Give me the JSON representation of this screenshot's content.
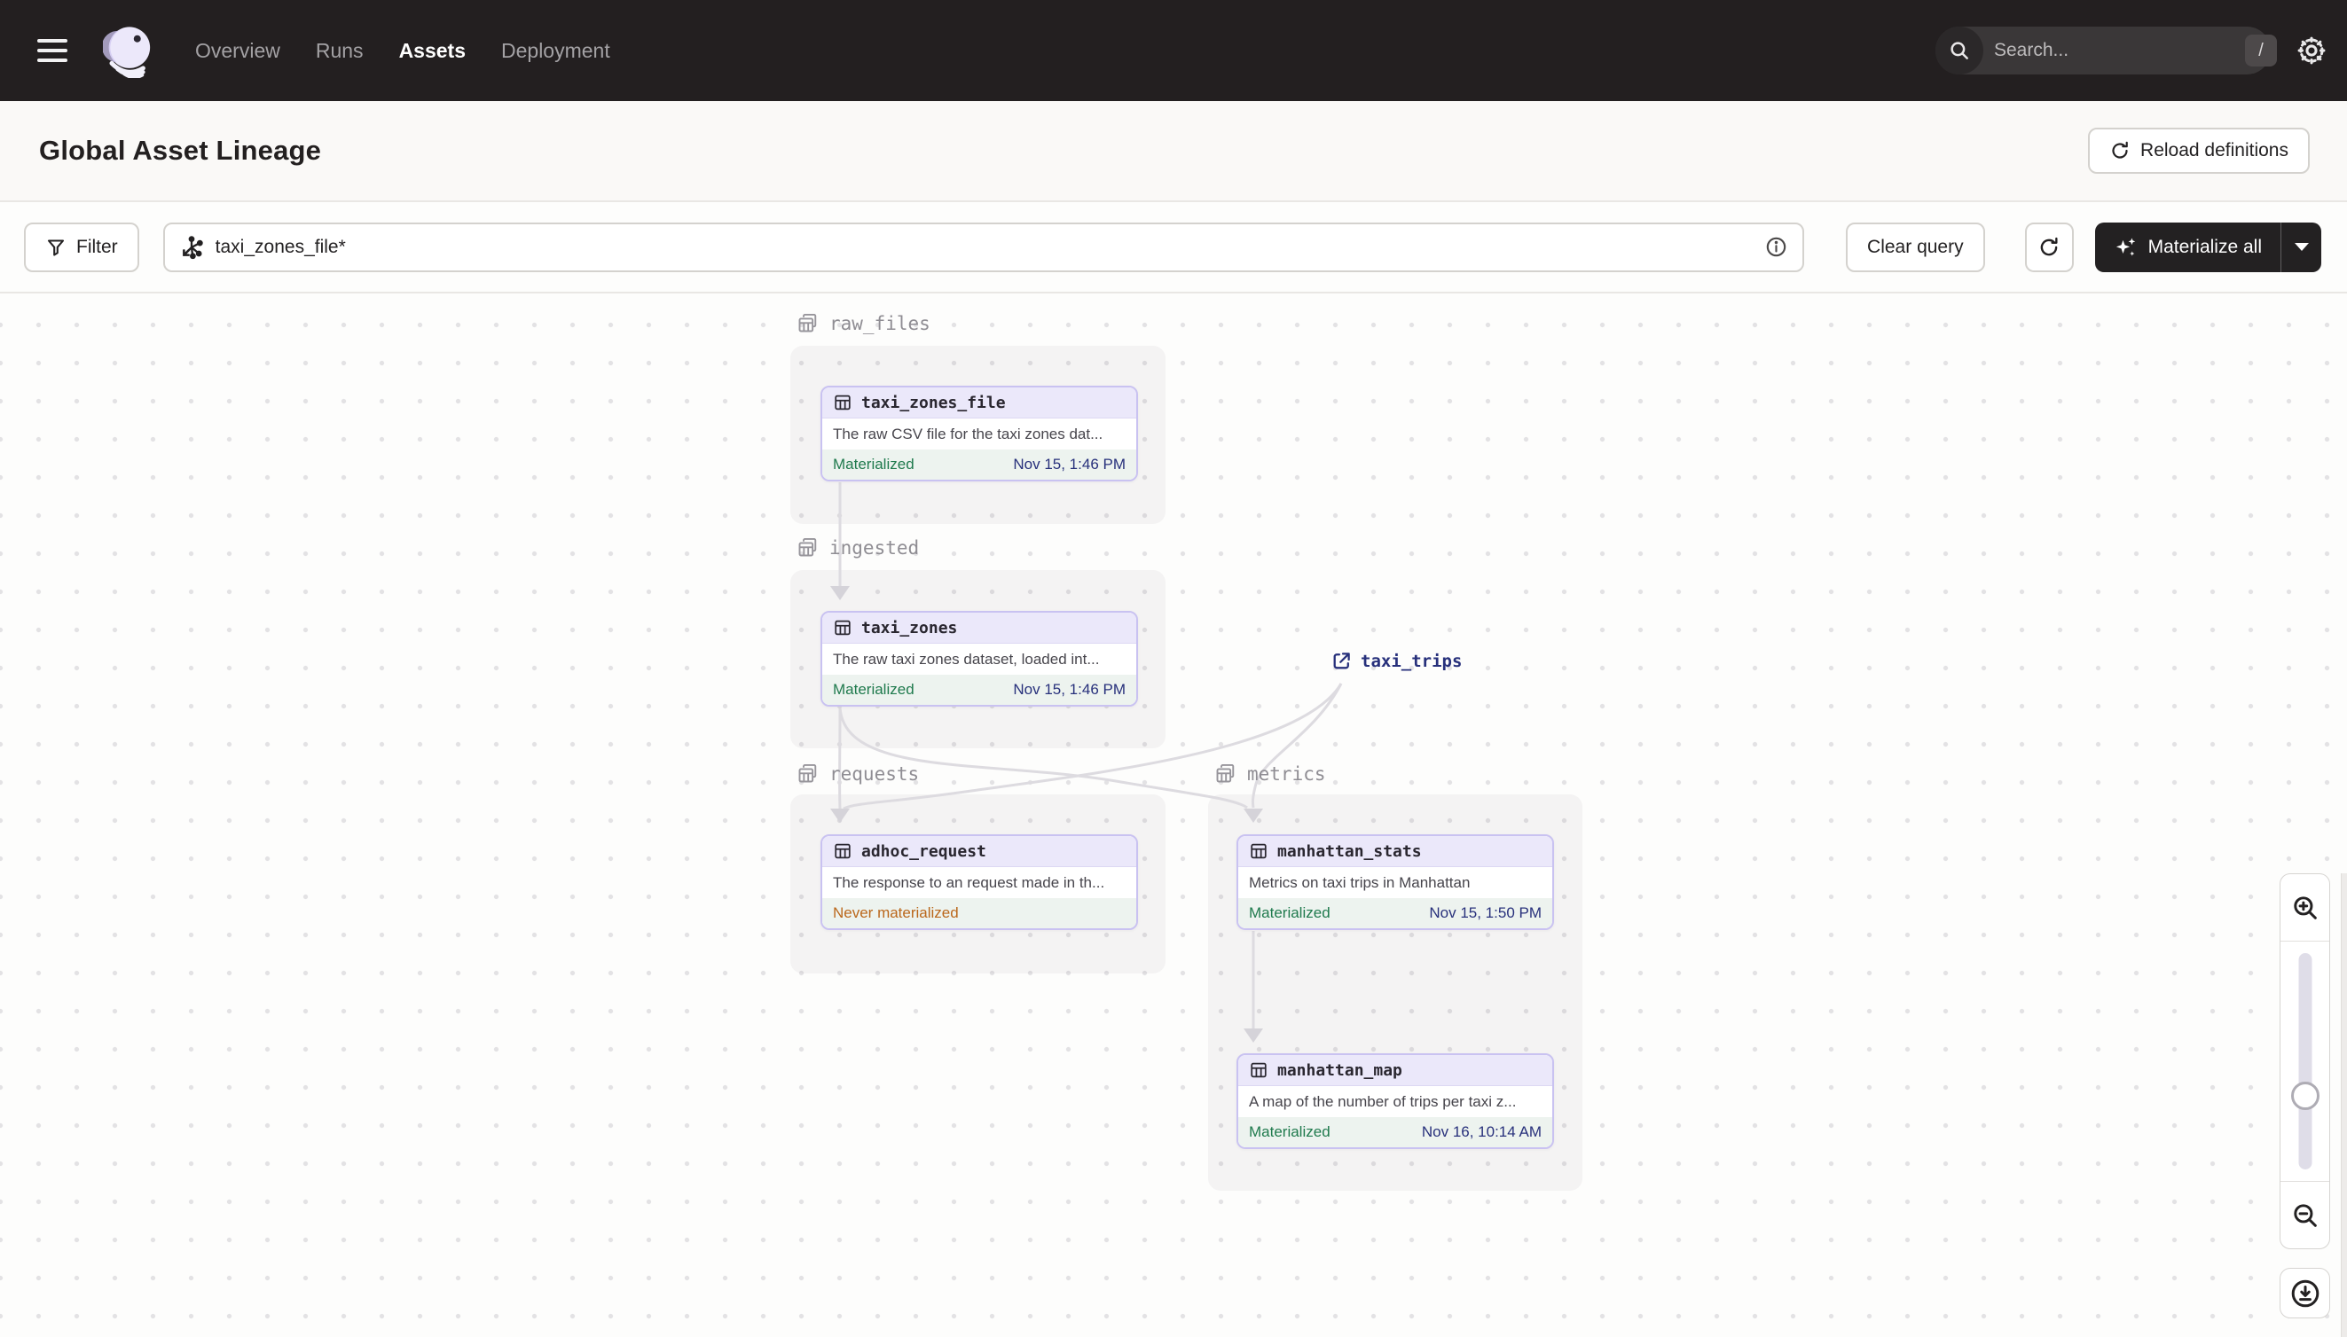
{
  "colors": {
    "nav_bg": "#231F20",
    "header_bg": "#FAF9F7",
    "node_border": "#C9C2F1",
    "node_header_bg": "#EBE8FA",
    "node_footer_bg": "#EDF3EF",
    "status_materialized": "#1F7A4D",
    "status_never_materialized": "#BA671B",
    "timestamp_navy": "#27307B",
    "group_label_gray": "#8F8D93",
    "edge_gray": "#DDDBE0"
  },
  "nav": {
    "items": [
      {
        "label": "Overview",
        "active": false
      },
      {
        "label": "Runs",
        "active": false
      },
      {
        "label": "Assets",
        "active": true
      },
      {
        "label": "Deployment",
        "active": false
      }
    ],
    "search_placeholder": "Search...",
    "search_shortcut": "/"
  },
  "header": {
    "title": "Global Asset Lineage",
    "reload_button": "Reload definitions"
  },
  "toolbar": {
    "filter_label": "Filter",
    "query_value": "taxi_zones_file*",
    "clear_button": "Clear query",
    "materialize_button": "Materialize all"
  },
  "graph": {
    "groups": [
      {
        "name": "raw_files"
      },
      {
        "name": "ingested"
      },
      {
        "name": "requests"
      },
      {
        "name": "metrics"
      }
    ],
    "nodes": [
      {
        "name": "taxi_zones_file",
        "group": "raw_files",
        "description": "The raw CSV file for the taxi zones dat...",
        "status": "Materialized",
        "time": "Nov 15, 1:46 PM"
      },
      {
        "name": "taxi_zones",
        "group": "ingested",
        "description": "The raw taxi zones dataset, loaded int...",
        "status": "Materialized",
        "time": "Nov 15, 1:46 PM"
      },
      {
        "name": "adhoc_request",
        "group": "requests",
        "description": "The response to an request made in th...",
        "status": "Never materialized",
        "time": ""
      },
      {
        "name": "manhattan_stats",
        "group": "metrics",
        "description": "Metrics on taxi trips in Manhattan",
        "status": "Materialized",
        "time": "Nov 15, 1:50 PM"
      },
      {
        "name": "manhattan_map",
        "group": "metrics",
        "description": "A map of the number of trips per taxi z...",
        "status": "Materialized",
        "time": "Nov 16, 10:14 AM"
      }
    ],
    "external_assets": [
      {
        "name": "taxi_trips"
      }
    ],
    "edges": [
      {
        "from": "taxi_zones_file",
        "to": "taxi_zones"
      },
      {
        "from": "taxi_zones",
        "to": "adhoc_request"
      },
      {
        "from": "taxi_zones",
        "to": "manhattan_stats"
      },
      {
        "from": "taxi_trips",
        "to": "adhoc_request"
      },
      {
        "from": "taxi_trips",
        "to": "manhattan_stats"
      },
      {
        "from": "manhattan_stats",
        "to": "manhattan_map"
      }
    ]
  },
  "zoom_controls": {
    "slider_position_percent": 42
  }
}
